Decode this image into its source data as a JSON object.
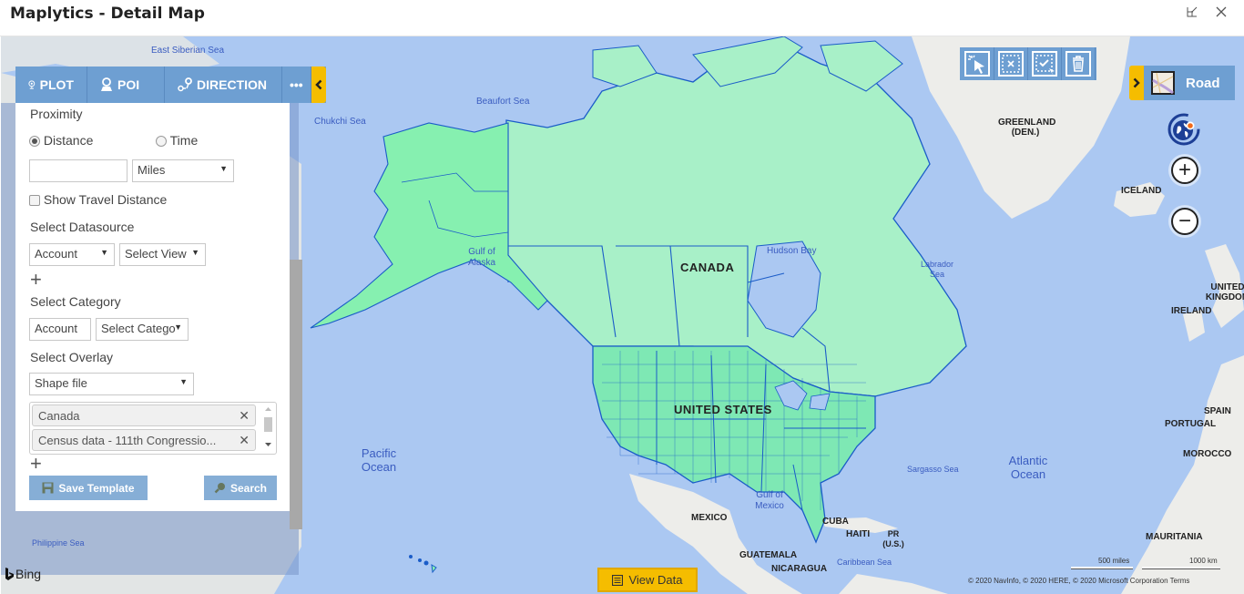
{
  "window": {
    "title": "Maplytics - Detail Map",
    "restore_icon": "restore-window-icon",
    "close_icon": "close-icon"
  },
  "toolbar": {
    "items": [
      {
        "label": "PLOT",
        "icon": "map-pin-icon"
      },
      {
        "label": "POI",
        "icon": "person-pin-icon"
      },
      {
        "label": "DIRECTION",
        "icon": "route-icon"
      }
    ],
    "more_label": "•••",
    "collapse_icon": "chevron-left-icon"
  },
  "panel": {
    "proximity_label": "Proximity",
    "radio_distance": "Distance",
    "radio_time": "Time",
    "radio_selected": "Distance",
    "distance_value": "",
    "unit_select": "Miles",
    "show_travel_distance": "Show Travel Distance",
    "show_travel_distance_checked": false,
    "datasource_label": "Select Datasource",
    "datasource_select": "Account",
    "view_select": "Select View",
    "category_label": "Select Category",
    "category_entity": "Account",
    "category_select": "Select Catego",
    "overlay_label": "Select Overlay",
    "overlay_select": "Shape file",
    "overlay_tags": [
      "Canada",
      "Census data - 111th Congressio..."
    ],
    "save_template_label": "Save Template",
    "search_label": "Search"
  },
  "right_tools": {
    "items": [
      "select-pointer-icon",
      "clear-selection-icon",
      "select-region-icon",
      "delete-icon"
    ],
    "map_style_label": "Road",
    "expand_icon": "chevron-right-icon",
    "zoom_in": "+",
    "zoom_out": "−"
  },
  "map_labels": {
    "seas": [
      {
        "text": "East Siberian Sea"
      },
      {
        "text": "Beaufort Sea"
      },
      {
        "text": "Chukchi Sea"
      },
      {
        "text": "Gulf of Alaska"
      },
      {
        "text": "Hudson Bay"
      },
      {
        "text": "Labrador Sea"
      },
      {
        "text": "Pacific Ocean"
      },
      {
        "text": "Gulf of Mexico"
      },
      {
        "text": "Sargasso Sea"
      },
      {
        "text": "Atlantic Ocean"
      },
      {
        "text": "Caribbean Sea"
      },
      {
        "text": "Philippine Sea"
      }
    ],
    "countries": [
      {
        "text": "CANADA"
      },
      {
        "text": "UNITED STATES"
      },
      {
        "text": "GREENLAND (DEN.)"
      },
      {
        "text": "ICELAND"
      },
      {
        "text": "UNITED KINGDOM"
      },
      {
        "text": "IRELAND"
      },
      {
        "text": "SPAIN"
      },
      {
        "text": "PORTUGAL"
      },
      {
        "text": "MOROCCO"
      },
      {
        "text": "MAURITANIA"
      },
      {
        "text": "MEXICO"
      },
      {
        "text": "CUBA"
      },
      {
        "text": "HAITI"
      },
      {
        "text": "PR (U.S.)"
      },
      {
        "text": "GUATEMALA"
      },
      {
        "text": "NICARAGUA"
      }
    ]
  },
  "footer": {
    "view_data_label": "View Data",
    "bing_label": "Bing",
    "scale_miles": "500 miles",
    "scale_km": "1000 km",
    "copyright": "© 2020 NavInfo, © 2020 HERE, © 2020 Microsoft Corporation  Terms"
  },
  "colors": {
    "accent_blue": "#6e9fd2",
    "accent_yellow": "#f5bd00",
    "ocean": "#abc8f2",
    "shape_fill": "#a8f0c8",
    "shape_border": "#1a5cc8"
  }
}
